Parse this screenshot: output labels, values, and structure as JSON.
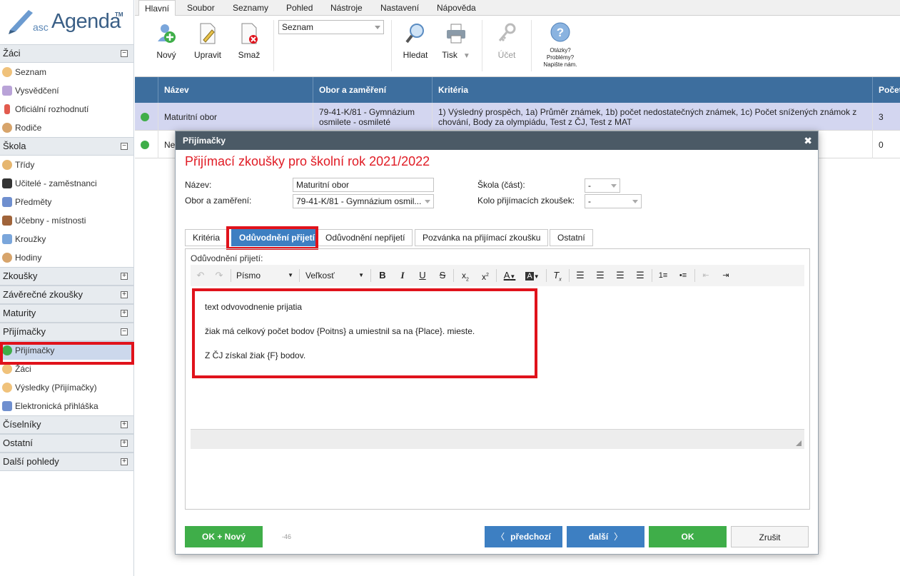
{
  "logo": {
    "asc": "asc",
    "agenda": "Agenda",
    "tm": "TM"
  },
  "sidebar": {
    "sections": [
      {
        "title": "Žáci",
        "toggle": "−",
        "items": [
          "Seznam",
          "Vysvědčení",
          "Oficiální rozhodnutí",
          "Rodiče"
        ]
      },
      {
        "title": "Škola",
        "toggle": "−",
        "items": [
          "Třídy",
          "Učitelé - zaměstnanci",
          "Předměty",
          "Učebny - místnosti",
          "Kroužky",
          "Hodiny"
        ]
      },
      {
        "title": "Zkoušky",
        "toggle": "+"
      },
      {
        "title": "Závěrečné zkoušky",
        "toggle": "+"
      },
      {
        "title": "Maturity",
        "toggle": "+"
      },
      {
        "title": "Přijímačky",
        "toggle": "−",
        "items": [
          "Přijímačky",
          "Žáci",
          "Výsledky (Přijímačky)",
          "Elektronická přihláška"
        ]
      },
      {
        "title": "Číselníky",
        "toggle": "+"
      },
      {
        "title": "Ostatní",
        "toggle": "+"
      },
      {
        "title": "Další pohledy",
        "toggle": "+"
      }
    ]
  },
  "menu_tabs": [
    "Hlavní",
    "Soubor",
    "Seznamy",
    "Pohled",
    "Nástroje",
    "Nastavení",
    "Nápověda"
  ],
  "ribbon": {
    "new": "Nový",
    "edit": "Upravit",
    "delete": "Smaž",
    "view_select": "Seznam",
    "search": "Hledat",
    "print": "Tisk",
    "account": "Účet",
    "help_line1": "Otázky?",
    "help_line2": "Problémy?",
    "help_line3": "Napište nám."
  },
  "grid": {
    "columns": [
      "Název",
      "Obor a zaměření",
      "Kritéria",
      "Počet"
    ],
    "rows": [
      {
        "name": "Maturitní obor",
        "field": "79-41-K/81 - Gymnázium osmilete - osmileté",
        "criteria": "1) Výsledný prospěch, 1a) Průměr známek, 1b) počet nedostatečných známek, 1c) Počet snížených známok z chování, Body za olympiádu, Test z ČJ, Test z MAT",
        "count": "3"
      },
      {
        "name": "Ne",
        "field": "",
        "criteria": "",
        "count": "0"
      }
    ]
  },
  "dialog": {
    "title": "Přijímačky",
    "close": "✖",
    "heading": "Přijímací zkoušky pro školní rok 2021/2022",
    "labels": {
      "name": "Název:",
      "field": "Obor a zaměření:",
      "school": "Škola (část):",
      "round": "Kolo přijímacích zkoušek:"
    },
    "values": {
      "name": "Maturitní obor",
      "field": "79-41-K/81 - Gymnázium osmil...",
      "school": "-",
      "round": "-"
    },
    "tabs": [
      "Kritéria",
      "Odůvodnění přijetí",
      "Odůvodnění nepřijetí",
      "Pozvánka na přijímací zkoušku",
      "Ostatní"
    ],
    "editor_label": "Odůvodnění přijetí:",
    "toolbar": {
      "font": "Písmo",
      "size": "Veľkosť"
    },
    "content": [
      "text odvovodnenie prijatia",
      "žiak má celkový počet bodov {Poitns} a umiestnil sa na {Place}. mieste.",
      "Z ČJ získal žiak {F} bodov."
    ],
    "buttons": {
      "ok_new": "OK + Nový",
      "counter": "-46",
      "prev": "předchozí",
      "next": "další",
      "ok": "OK",
      "cancel": "Zrušit"
    }
  },
  "colors": {
    "header_blue": "#3d6e9e",
    "accent_red": "#e01b24",
    "green": "#3fae49",
    "button_blue": "#3d7fc2"
  }
}
